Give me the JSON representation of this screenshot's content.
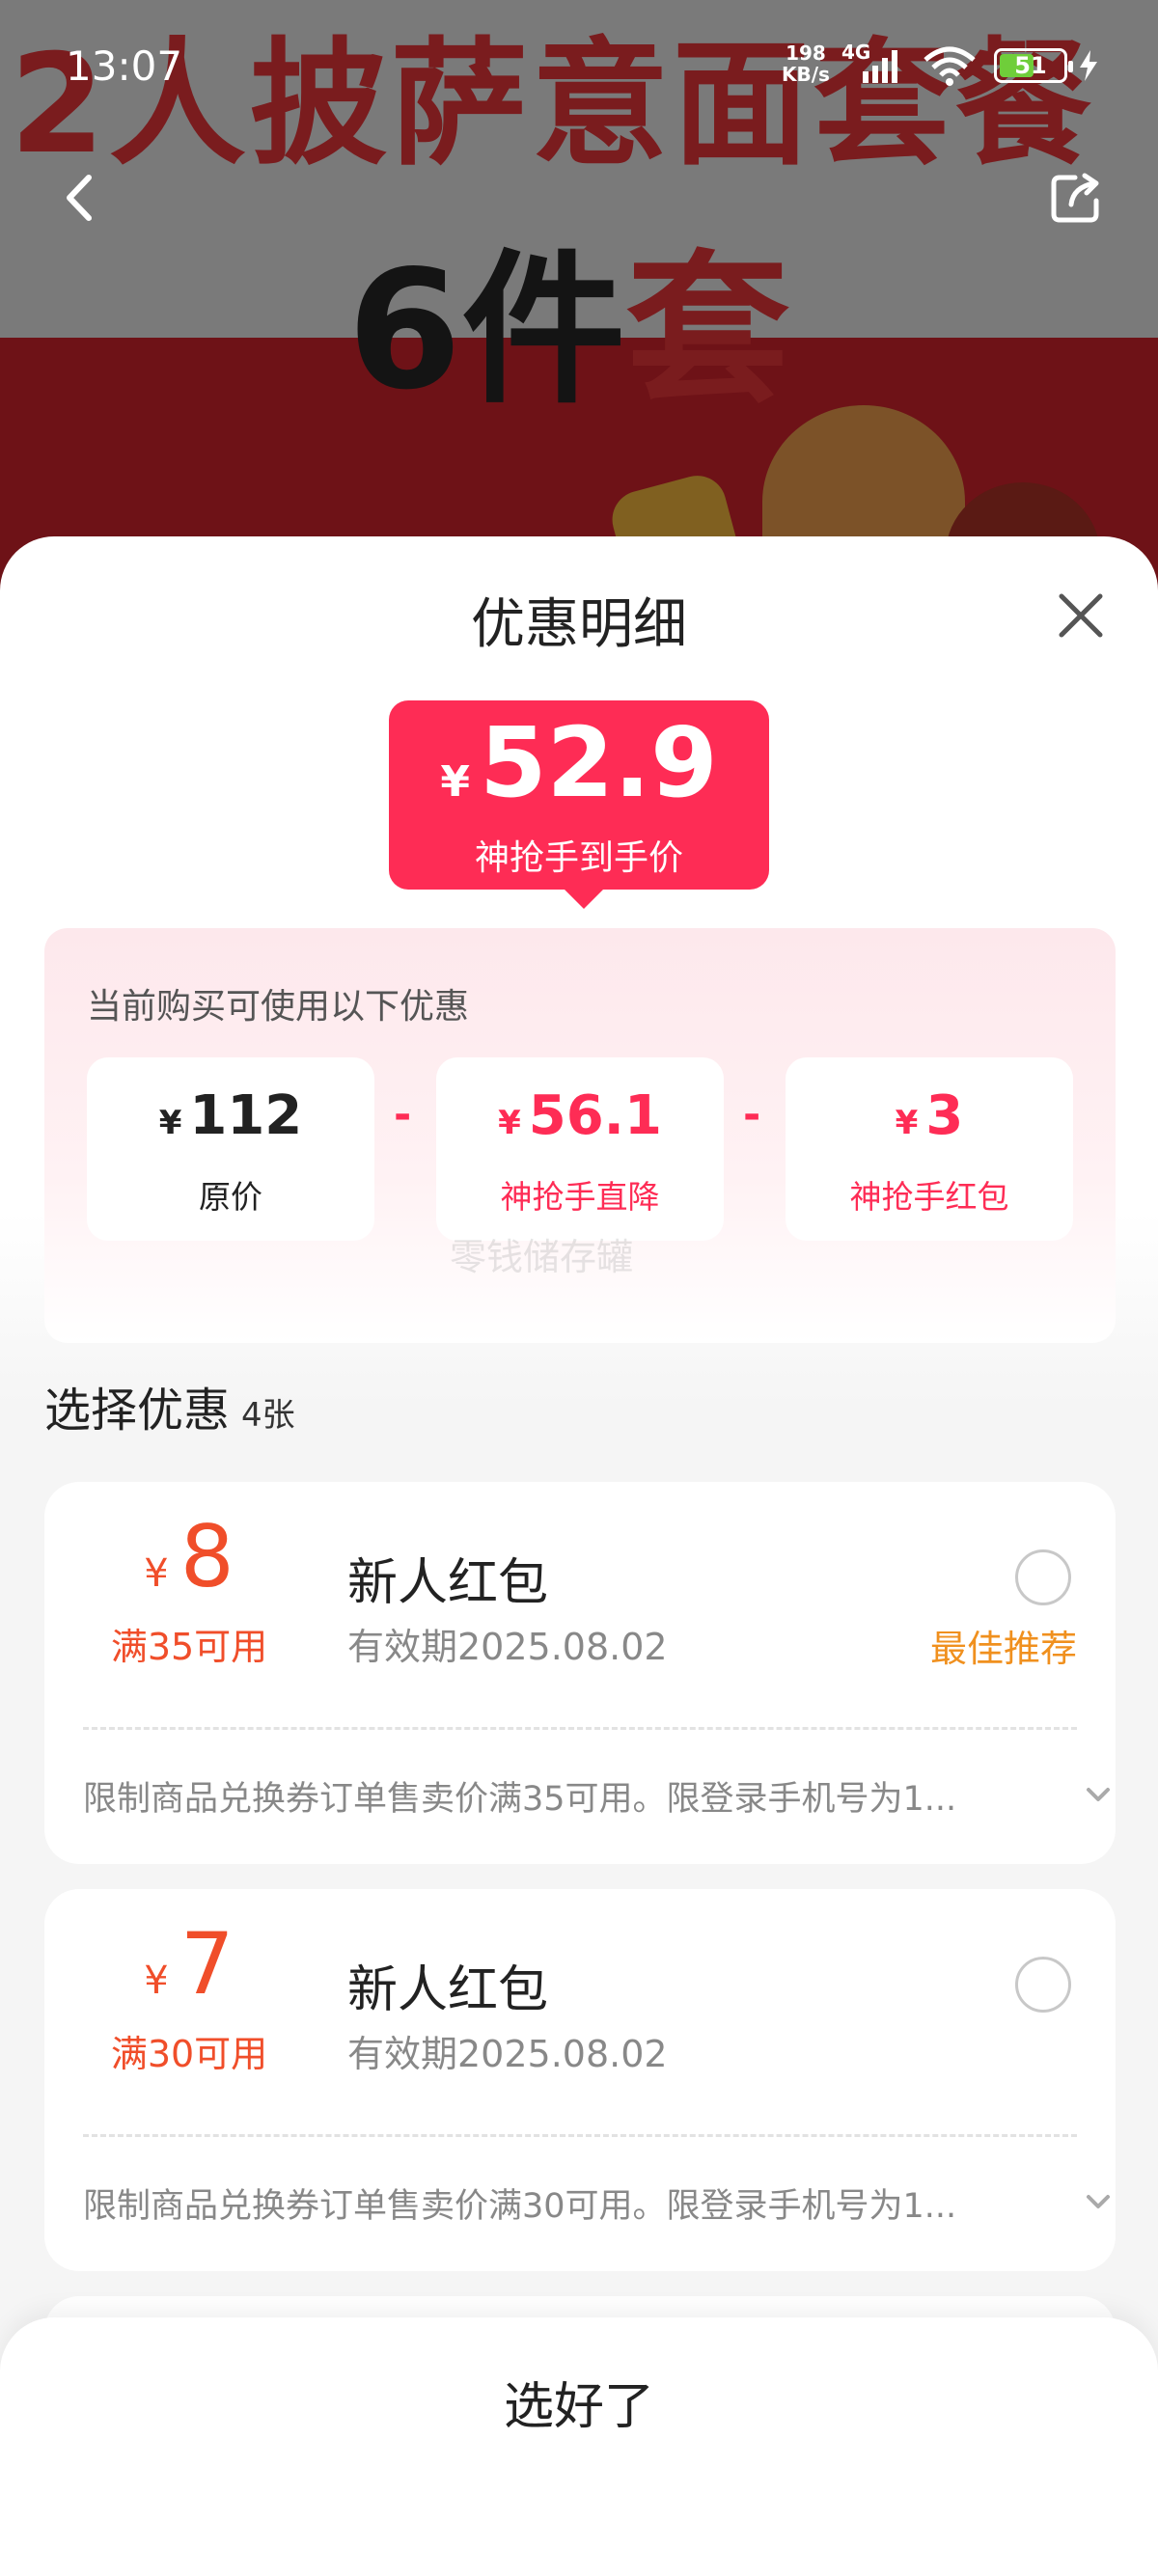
{
  "status_bar": {
    "time": "13:07",
    "net_speed_value": "198",
    "net_speed_unit": "KB/s",
    "network_type": "4G",
    "battery": "51"
  },
  "banner": {
    "line1": "2人披萨意面套餐",
    "line2_dark": "6件",
    "line2_red": "套"
  },
  "sheet": {
    "title": "优惠明细",
    "price": {
      "currency": "¥",
      "amount": "52.9",
      "label": "神抢手到手价"
    },
    "discount_hint": "当前购买可使用以下优惠",
    "discounts": [
      {
        "currency": "¥",
        "value": "112",
        "label": "原价"
      },
      {
        "currency": "¥",
        "value": "56.1",
        "label": "神抢手直降"
      },
      {
        "currency": "¥",
        "value": "3",
        "label": "神抢手红包"
      }
    ],
    "minus": "-",
    "watermark": "零钱储存罐",
    "select_title": "选择优惠",
    "select_count": "4张",
    "coupons": [
      {
        "currency": "¥",
        "amount": "8",
        "condition": "满35可用",
        "name": "新人红包",
        "validity": "有效期2025.08.02",
        "tag": "最佳推荐",
        "rule": "限制商品兑换券订单售卖价满35可用。限登录手机号为1..."
      },
      {
        "currency": "¥",
        "amount": "7",
        "condition": "满30可用",
        "name": "新人红包",
        "validity": "有效期2025.08.02",
        "tag": "",
        "rule": "限制商品兑换券订单售卖价满30可用。限登录手机号为1..."
      }
    ],
    "confirm_label": "选好了"
  },
  "colors": {
    "accent_pink": "#fe2c55",
    "coupon_red": "#f04e2a",
    "best_orange": "#f0901e"
  },
  "icons": [
    "back-arrow-icon",
    "share-icon",
    "close-icon",
    "chevron-down-icon",
    "radio-unchecked-icon",
    "signal-icon",
    "wifi-icon",
    "battery-icon",
    "charging-icon"
  ]
}
